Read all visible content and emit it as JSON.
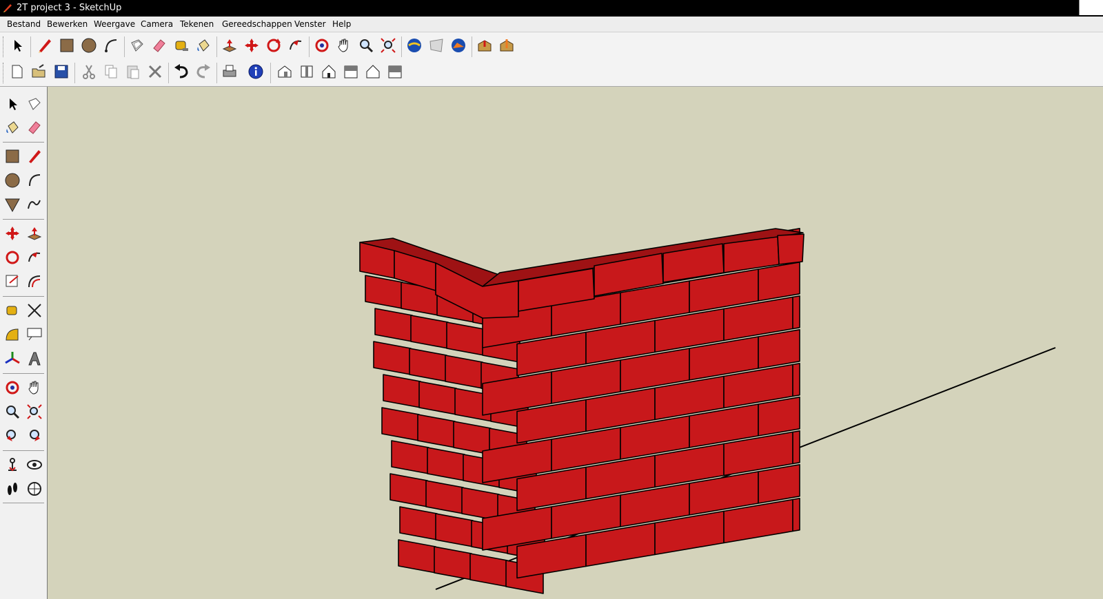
{
  "window": {
    "title": "2T project 3 - SketchUp"
  },
  "menu": {
    "items": [
      "Bestand",
      "Bewerken",
      "Weergave",
      "Camera",
      "Tekenen",
      "Gereedschappen",
      "Venster",
      "Help"
    ]
  },
  "toolbar_top": [
    "select-icon",
    "pencil-icon",
    "rectangle-icon",
    "circle-icon",
    "arc-icon",
    "make-component-icon",
    "eraser-icon",
    "tape-measure-icon",
    "paint-bucket-icon",
    "push-pull-icon",
    "move-icon",
    "rotate-icon",
    "follow-me-icon",
    "orbit-icon",
    "pan-icon",
    "zoom-icon",
    "zoom-extents-icon",
    "google-earth-icon",
    "get-current-view-icon",
    "toggle-terrain-icon",
    "get-models-icon",
    "share-model-icon"
  ],
  "toolbar_bottom": [
    "new-icon",
    "open-icon",
    "save-icon",
    "cut-icon",
    "copy-icon",
    "paste-icon",
    "delete-icon",
    "undo-icon",
    "redo-icon",
    "print-icon",
    "model-info-icon",
    "iso-view-icon",
    "top-view-icon",
    "front-view-icon",
    "right-view-icon",
    "back-view-icon",
    "left-view-icon"
  ],
  "left_tools": [
    "select-icon",
    "make-component-icon",
    "paint-bucket-icon",
    "eraser-icon",
    "rectangle-icon",
    "line-icon",
    "circle-icon",
    "arc-icon",
    "polygon-icon",
    "freehand-icon",
    "move-icon",
    "push-pull-icon",
    "rotate-icon",
    "follow-me-icon",
    "scale-icon",
    "offset-icon",
    "tape-measure-icon",
    "dimension-icon",
    "protractor-icon",
    "text-icon",
    "axes-icon",
    "3d-text-icon",
    "orbit-icon",
    "pan-icon",
    "zoom-icon",
    "zoom-window-icon",
    "previous-view-icon",
    "next-view-icon",
    "position-camera-icon",
    "look-around-icon",
    "walk-icon",
    "section-plane-icon"
  ],
  "colors": {
    "brick": "#c8181b",
    "brick_top": "#9e1214",
    "ground": "#d4d3bb",
    "edge": "#000000"
  }
}
